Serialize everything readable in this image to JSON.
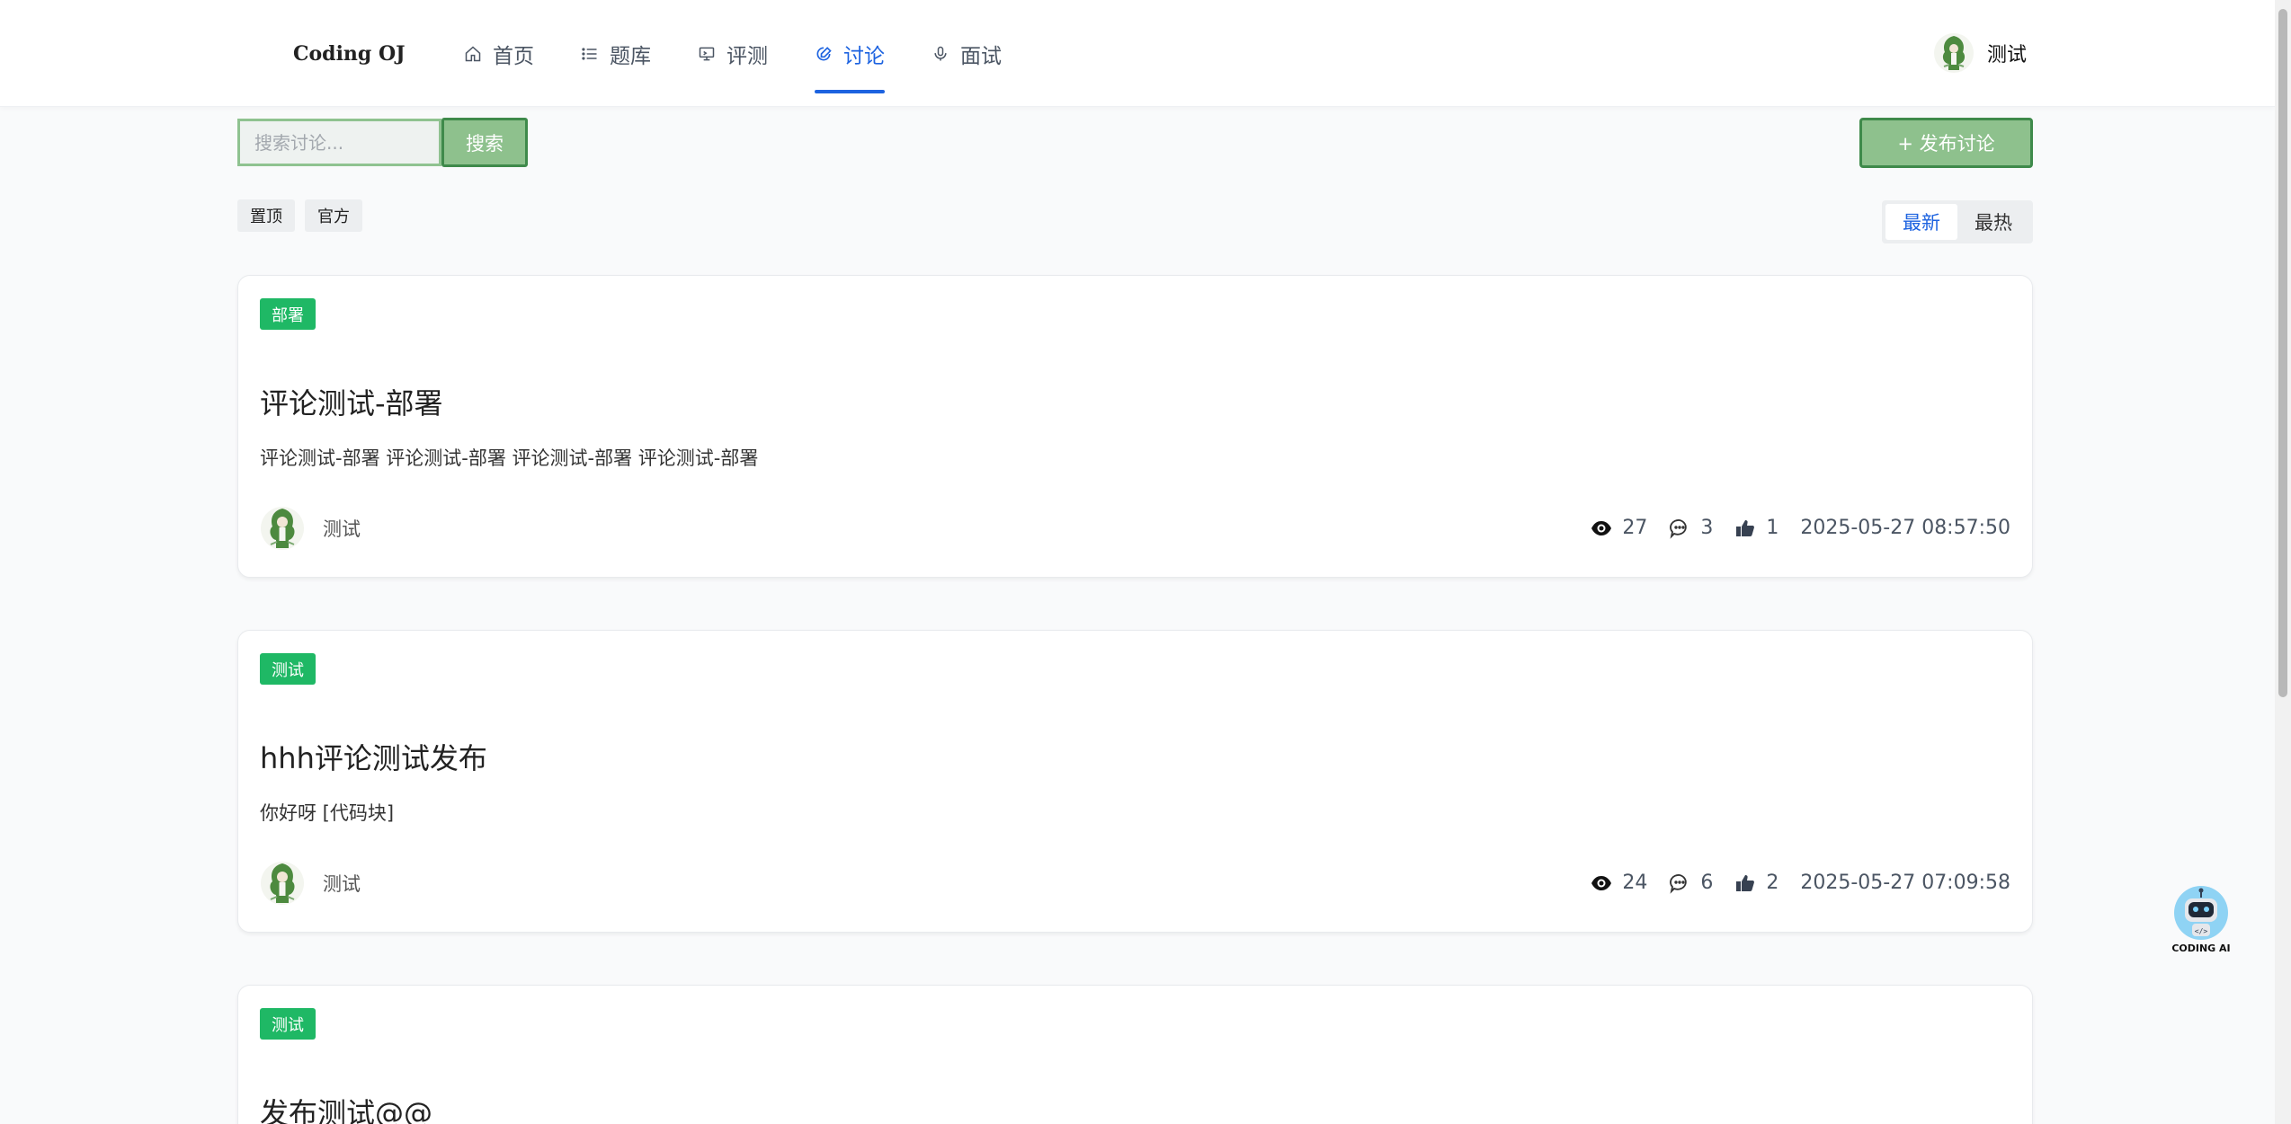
{
  "header": {
    "brand": "Coding OJ",
    "nav": [
      {
        "label": "首页",
        "icon": "home-icon"
      },
      {
        "label": "题库",
        "icon": "list-icon"
      },
      {
        "label": "评测",
        "icon": "monitor-icon"
      },
      {
        "label": "讨论",
        "icon": "chat-edit-icon",
        "active": true
      },
      {
        "label": "面试",
        "icon": "microphone-icon"
      }
    ],
    "user_name": "测试"
  },
  "toolbar": {
    "search_placeholder": "搜索讨论...",
    "search_button": "搜索",
    "publish_button": "+ 发布讨论",
    "filters": [
      "置顶",
      "官方"
    ],
    "sort": {
      "options": [
        "最新",
        "最热"
      ],
      "selected": "最新"
    }
  },
  "posts": [
    {
      "tag": "部署",
      "title": "评论测试-部署",
      "excerpt": "评论测试-部署 评论测试-部署 评论测试-部署 评论测试-部署",
      "author": "测试",
      "views": "27",
      "comments": "3",
      "likes": "1",
      "date": "2025-05-27 08:57:50"
    },
    {
      "tag": "测试",
      "title": "hhh评论测试发布",
      "excerpt": "你好呀 [代码块]",
      "author": "测试",
      "views": "24",
      "comments": "6",
      "likes": "2",
      "date": "2025-05-27 07:09:58"
    },
    {
      "tag": "测试",
      "title": "发布测试@@"
    }
  ],
  "ai_assistant": {
    "label": "CODING AI"
  },
  "colors": {
    "accent": "#1d63e0",
    "button_green": "#8ec18d",
    "button_border": "#3f8a4b",
    "tag_green": "#1fb865"
  }
}
